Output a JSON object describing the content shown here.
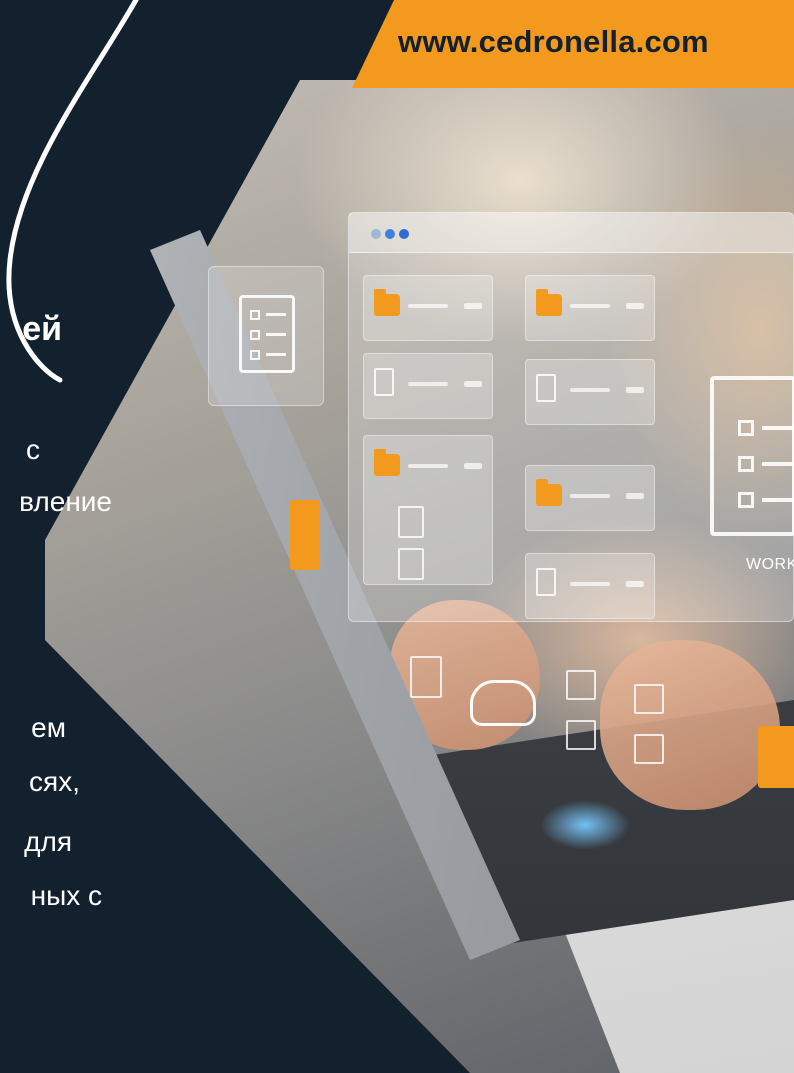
{
  "header": {
    "url": "www.cedronella.com"
  },
  "heading_fragment": "ей",
  "body_fragments": [
    "с",
    "вление",
    "ем",
    "сях,",
    "для",
    "ных с"
  ],
  "holo_ui": {
    "work_label": "WORK"
  },
  "colors": {
    "background": "#13212e",
    "accent": "#f39a1e",
    "text": "#ffffff"
  }
}
